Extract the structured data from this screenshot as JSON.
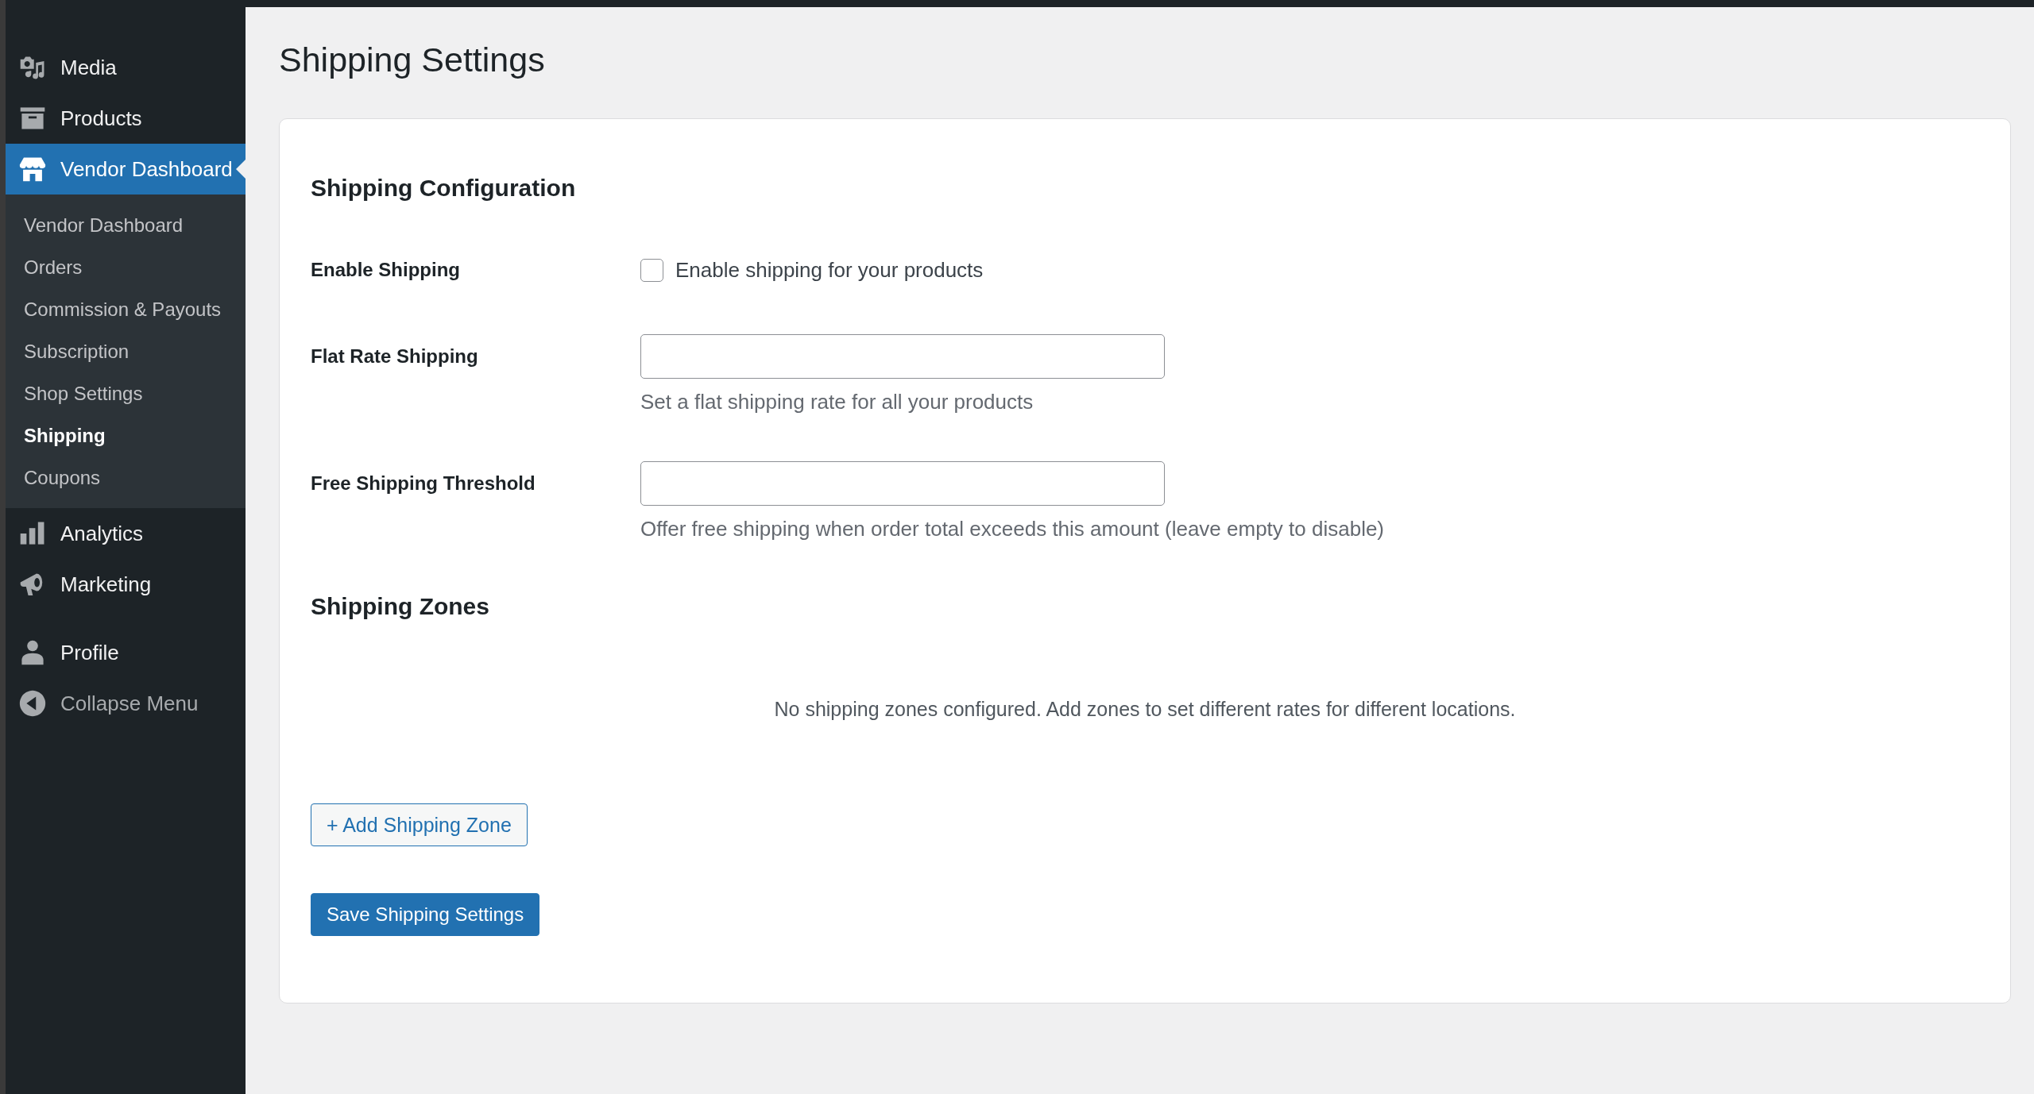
{
  "sidebar": {
    "menu": [
      {
        "label": "Media",
        "selected": false
      },
      {
        "label": "Products",
        "selected": false
      },
      {
        "label": "Vendor Dashboard",
        "selected": true,
        "children": [
          {
            "label": "Vendor Dashboard",
            "selected": false
          },
          {
            "label": "Orders",
            "selected": false
          },
          {
            "label": "Commission & Payouts",
            "selected": false
          },
          {
            "label": "Subscription",
            "selected": false
          },
          {
            "label": "Shop Settings",
            "selected": false
          },
          {
            "label": "Shipping",
            "selected": true
          },
          {
            "label": "Coupons",
            "selected": false
          }
        ]
      },
      {
        "label": "Analytics",
        "selected": false
      },
      {
        "label": "Marketing",
        "selected": false
      },
      {
        "label": "Profile",
        "selected": false
      }
    ],
    "collapse": {
      "label": "Collapse Menu"
    }
  },
  "page": {
    "title": "Shipping Settings"
  },
  "card": {
    "sections": [
      {
        "heading": "Shipping Configuration",
        "fields": [
          {
            "kind": "checkbox",
            "label": "Enable Shipping",
            "option": "Enable shipping for your products",
            "checked": false
          },
          {
            "kind": "text",
            "label": "Flat Rate Shipping",
            "hint": "Set a flat shipping rate for all your products"
          },
          {
            "kind": "text",
            "label": "Free Shipping Threshold",
            "hint": "Offer free shipping when order total exceeds this amount (leave empty to disable)"
          }
        ]
      },
      {
        "heading": "Shipping Zones",
        "empty_message": "No shipping zones configured. Add zones to set different rates for different locations.",
        "add_button": "+ Add Shipping Zone"
      }
    ],
    "save_button": "Save Shipping Settings"
  }
}
